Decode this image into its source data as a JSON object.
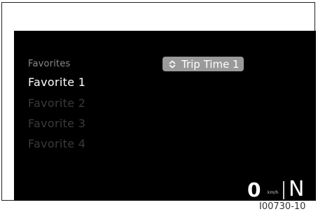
{
  "menu": {
    "heading": "Favorites",
    "items": [
      {
        "label": "Favorite 1",
        "state": "selected"
      },
      {
        "label": "Favorite 2",
        "state": "dim"
      },
      {
        "label": "Favorite 3",
        "state": "dim"
      },
      {
        "label": "Favorite 4",
        "state": "dim"
      }
    ]
  },
  "trip_chip": {
    "label": "Trip Time 1",
    "icon": "up-down-toggle-icon"
  },
  "status": {
    "speed": "0",
    "speed_unit": "km/h",
    "gear": "N"
  },
  "figure_code": "I00730-10",
  "colors": {
    "screen_bg": "#000000",
    "chip_bg": "#9a9a9a",
    "selected_text": "#ffffff",
    "dim_text": "#3a3a3a",
    "heading_text": "#8a8a8a"
  }
}
